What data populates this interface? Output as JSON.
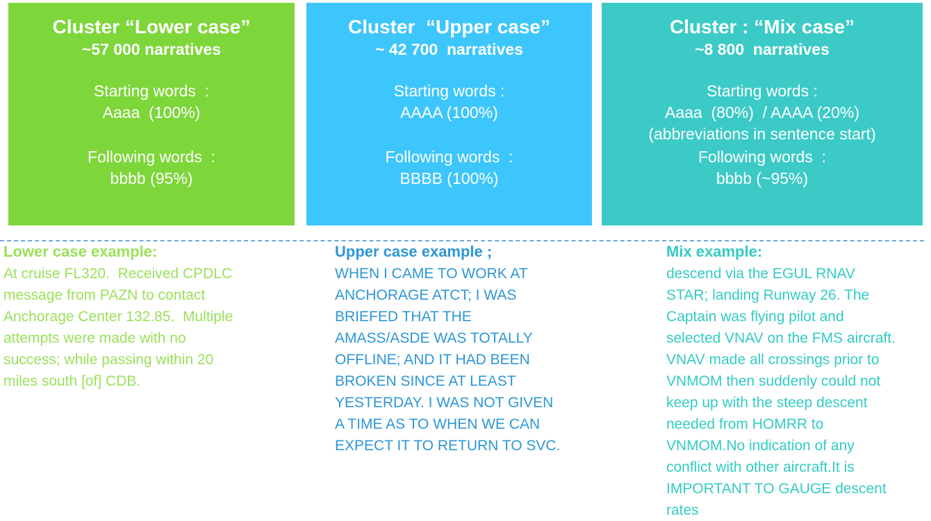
{
  "colors": {
    "lower_box": "#7dd63a",
    "upper_box": "#3dc6fb",
    "mix_box": "#3ccac6",
    "lower_text": "#9ae05a",
    "upper_text": "#2e96d4",
    "mix_text": "#33cbc4",
    "divider": "#6fa8dc"
  },
  "clusters": {
    "lower": {
      "title": "Cluster “Lower case”",
      "count": "~57 000 narratives",
      "starting_label": "Starting words  :",
      "starting_lines": [
        "Aaaa  (100%)"
      ],
      "following_label": "Following words  :",
      "following_lines": [
        "bbbb (95%)"
      ]
    },
    "upper": {
      "title": "Cluster  “Upper case”",
      "count": "~ 42 700  narratives",
      "starting_label": "Starting words :",
      "starting_lines": [
        "AAAA (100%)"
      ],
      "following_label": "Following words  :",
      "following_lines": [
        "BBBB (100%)"
      ]
    },
    "mix": {
      "title": "Cluster : “Mix case”",
      "count": "~8 800  narratives",
      "starting_label": "Starting words :",
      "starting_lines": [
        "Aaaa  (80%)  / AAAA (20%)",
        "(abbreviations in sentence start)"
      ],
      "following_label": "Following words  :",
      "following_lines": [
        "bbbb (~95%)"
      ]
    }
  },
  "examples": {
    "lower": {
      "heading": "Lower case example:",
      "lines": [
        "At cruise FL320.  Received CPDLC",
        "message from PAZN to contact",
        "Anchorage Center 132.85.  Multiple",
        "attempts were made with no",
        "success; while passing within 20",
        "miles south [of] CDB."
      ]
    },
    "upper": {
      "heading": "Upper case example ;",
      "lines": [
        "WHEN I CAME TO WORK AT",
        "ANCHORAGE ATCT; I WAS",
        "BRIEFED THAT THE",
        "AMASS/ASDE WAS TOTALLY",
        "OFFLINE; AND IT HAD BEEN",
        "BROKEN SINCE AT LEAST",
        "YESTERDAY. I WAS NOT GIVEN",
        "A TIME AS TO WHEN WE CAN",
        "EXPECT IT TO RETURN TO SVC."
      ]
    },
    "mix": {
      "heading": "Mix example:",
      "lines": [
        "descend via the EGUL RNAV",
        "STAR; landing Runway 26. The",
        "Captain was flying pilot and",
        "selected VNAV on the FMS aircraft.",
        "VNAV made all crossings prior to",
        "VNMOM then suddenly could not",
        "keep up with the steep descent",
        "needed from HOMRR to",
        "VNMOM.No indication of any",
        "conflict with other aircraft.It is",
        "IMPORTANT TO GAUGE descent",
        "rates"
      ]
    }
  }
}
